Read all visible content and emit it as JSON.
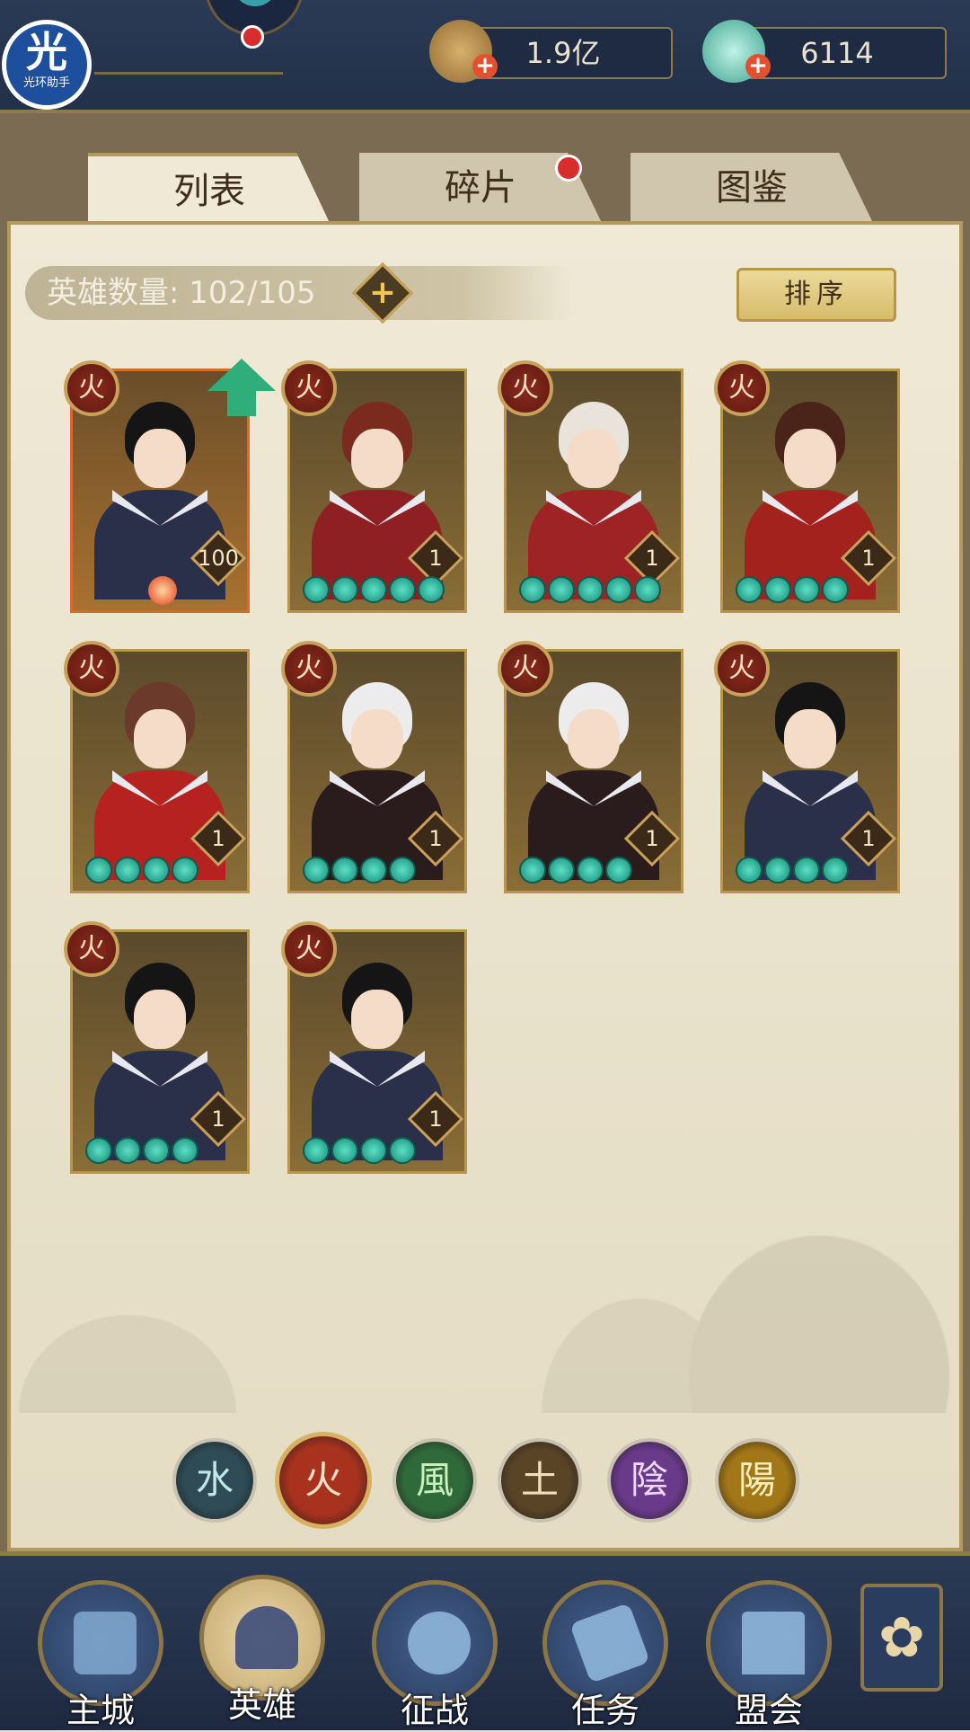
{
  "helper_badge": {
    "big": "光",
    "small": "光环助手"
  },
  "currency": {
    "copper": {
      "value": "1.9亿",
      "icon": "copper-coin-icon"
    },
    "jade": {
      "value": "6114",
      "icon": "jade-shell-icon"
    }
  },
  "tabs": [
    {
      "label": "列表",
      "active": true
    },
    {
      "label": "碎片",
      "active": false,
      "has_notification": true
    },
    {
      "label": "图鉴",
      "active": false
    }
  ],
  "hero_count": {
    "label": "英雄数量: 102/105"
  },
  "sort_button": {
    "label": "排序"
  },
  "element_glyph": "火",
  "heroes": [
    {
      "level": "100",
      "stars": 0,
      "upgradable": true,
      "hair": "#151515",
      "body": "#2a2f4a"
    },
    {
      "level": "1",
      "stars": 5,
      "hair": "#7a2b1e",
      "body": "#8e1f22"
    },
    {
      "level": "1",
      "stars": 5,
      "hair": "#e8e4dc",
      "body": "#9d2325"
    },
    {
      "level": "1",
      "stars": 4,
      "hair": "#4a2418",
      "body": "#a3221d"
    },
    {
      "level": "1",
      "stars": 4,
      "hair": "#6b3a2a",
      "body": "#b5221f"
    },
    {
      "level": "1",
      "stars": 4,
      "hair": "#ececec",
      "body": "#2a1c1c"
    },
    {
      "level": "1",
      "stars": 4,
      "hair": "#ececec",
      "body": "#2a1c1c"
    },
    {
      "level": "1",
      "stars": 4,
      "hair": "#151515",
      "body": "#2a2f4a"
    },
    {
      "level": "1",
      "stars": 4,
      "hair": "#151515",
      "body": "#2a2f4a"
    },
    {
      "level": "1",
      "stars": 4,
      "hair": "#151515",
      "body": "#2a2f4a"
    }
  ],
  "element_filters": [
    {
      "glyph": "水",
      "color": "#2f4b55",
      "text": "#bfe9e6"
    },
    {
      "glyph": "火",
      "color": "#a8321e",
      "text": "#f6e0c9",
      "selected": true
    },
    {
      "glyph": "風",
      "color": "#2f6a3a",
      "text": "#c8f0b7"
    },
    {
      "glyph": "土",
      "color": "#5a4426",
      "text": "#f0dfb9"
    },
    {
      "glyph": "陰",
      "color": "#6a3a8a",
      "text": "#efd7ff"
    },
    {
      "glyph": "陽",
      "color": "#a27717",
      "text": "#ffefbf"
    }
  ],
  "nav": [
    {
      "label": "主城"
    },
    {
      "label": "英雄",
      "active": true
    },
    {
      "label": "征战"
    },
    {
      "label": "任务"
    },
    {
      "label": "盟会"
    }
  ]
}
